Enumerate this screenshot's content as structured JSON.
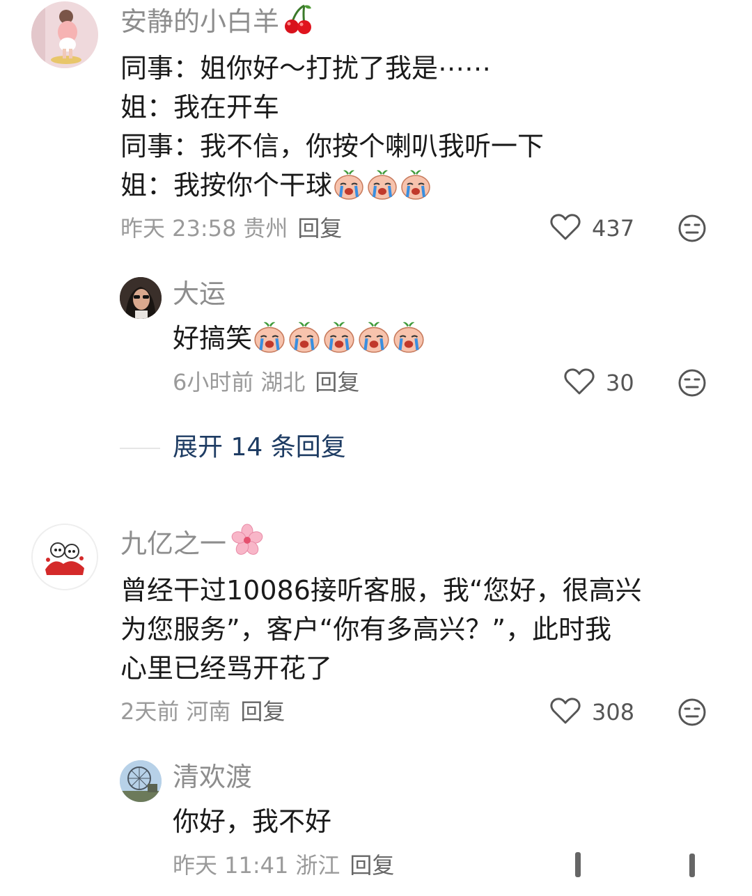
{
  "comments": [
    {
      "username": "安静的小白羊",
      "name_emoji": "cherry-emoji",
      "lines": [
        "同事：姐你好～打扰了我是⋯⋯",
        "姐：我在开车",
        "同事：我不信，你按个喇叭我听一下",
        "姐：我按你个干球"
      ],
      "trailing_emojis": [
        "crying-emoji",
        "crying-emoji",
        "crying-emoji"
      ],
      "time": "昨天 23:58",
      "location": "贵州",
      "reply_label": "回复",
      "likes": "437",
      "reply": {
        "username": "大运",
        "text": "好搞笑",
        "trailing_emojis": [
          "crying-emoji",
          "crying-emoji",
          "crying-emoji",
          "crying-emoji",
          "crying-emoji"
        ],
        "time": "6小时前",
        "location": "湖北",
        "reply_label": "回复",
        "likes": "30"
      },
      "expand_label": "展开 14 条回复"
    },
    {
      "username": "九亿之一",
      "name_emoji": "cherry-blossom-emoji",
      "lines": [
        "曾经干过10086接听客服，我“您好，很高兴",
        "为您服务”，客户“你有多高兴？”，此时我",
        "心里已经骂开花了"
      ],
      "time": "2天前",
      "location": "河南",
      "reply_label": "回复",
      "likes": "308",
      "reply": {
        "username": "清欢渡",
        "text": "你好，我不好",
        "time": "昨天 11:41",
        "location": "浙江",
        "reply_label": "回复"
      }
    }
  ],
  "icons": {
    "like": "heart-outline-icon",
    "dislike": "meh-face-icon"
  },
  "colors": {
    "expand_link": "#1e3c63",
    "meta": "#9a9a9a",
    "name": "#8d8d8d"
  }
}
